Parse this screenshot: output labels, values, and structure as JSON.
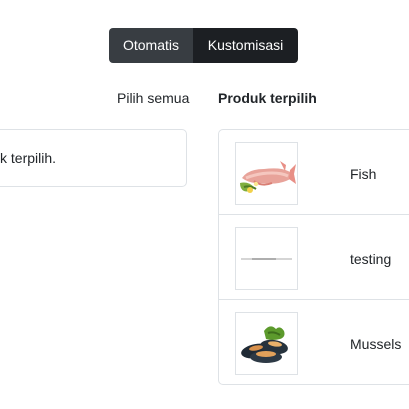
{
  "toggle": {
    "options": [
      "Otomatis",
      "Kustomisasi"
    ],
    "active": "Kustomisasi"
  },
  "actions": {
    "select_all_label": "Pilih semua"
  },
  "selected": {
    "title": "Produk terpilih",
    "items": [
      {
        "name": "Fish",
        "image": "fish-icon"
      },
      {
        "name": "testing",
        "image": "line-icon"
      },
      {
        "name": "Mussels",
        "image": "mussels-icon"
      }
    ]
  },
  "available": {
    "message": "k terpilih."
  }
}
